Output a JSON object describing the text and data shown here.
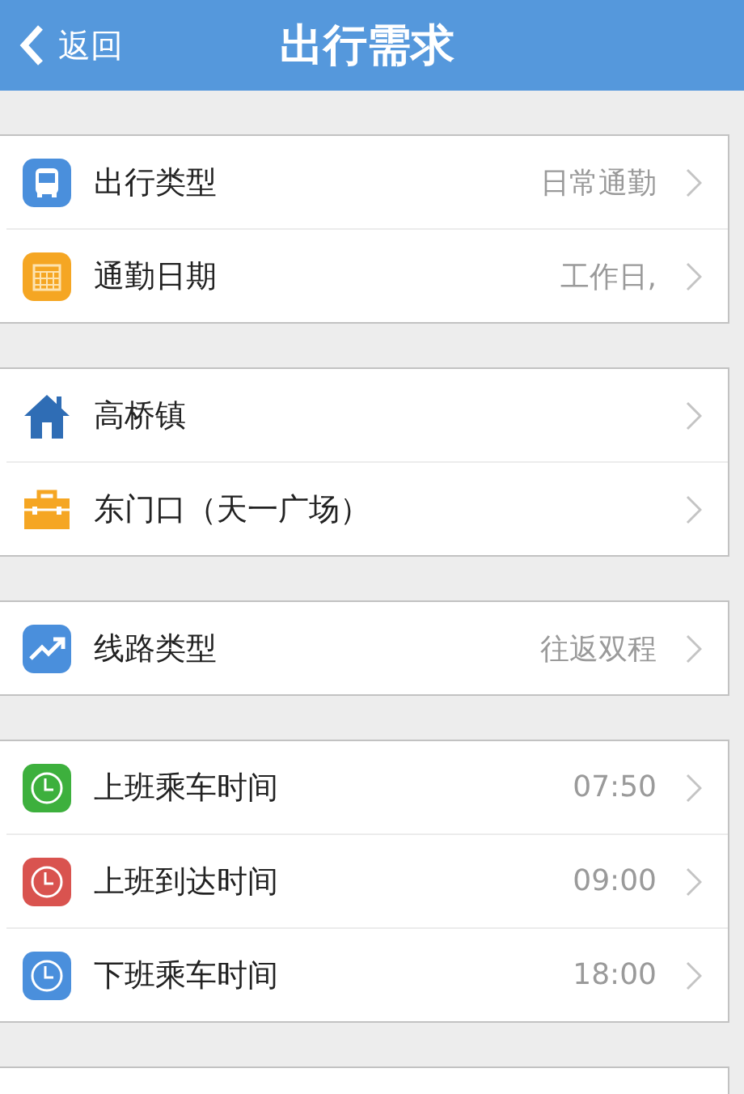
{
  "header": {
    "back_label": "返回",
    "title": "出行需求"
  },
  "groups": [
    {
      "rows": [
        {
          "kind": "bus",
          "color": "#4a8fdc",
          "label": "出行类型",
          "value": "日常通勤"
        },
        {
          "kind": "calendar",
          "color": "#f5a623",
          "label": "通勤日期",
          "value": "工作日,"
        }
      ]
    },
    {
      "rows": [
        {
          "kind": "house",
          "color": "#2f6db5",
          "label": "高桥镇"
        },
        {
          "kind": "briefcase",
          "color": "#f5a623",
          "label": "东门口（天一广场）"
        }
      ]
    },
    {
      "rows": [
        {
          "kind": "trend",
          "color": "#4a8fdc",
          "label": "线路类型",
          "value": "往返双程"
        }
      ]
    },
    {
      "rows": [
        {
          "kind": "clock",
          "color": "#3db03d",
          "label": "上班乘车时间",
          "value": "07:50"
        },
        {
          "kind": "clock",
          "color": "#d9534f",
          "label": "上班到达时间",
          "value": "09:00"
        },
        {
          "kind": "clock",
          "color": "#4a8fdc",
          "label": "下班乘车时间",
          "value": "18:00"
        }
      ]
    }
  ]
}
